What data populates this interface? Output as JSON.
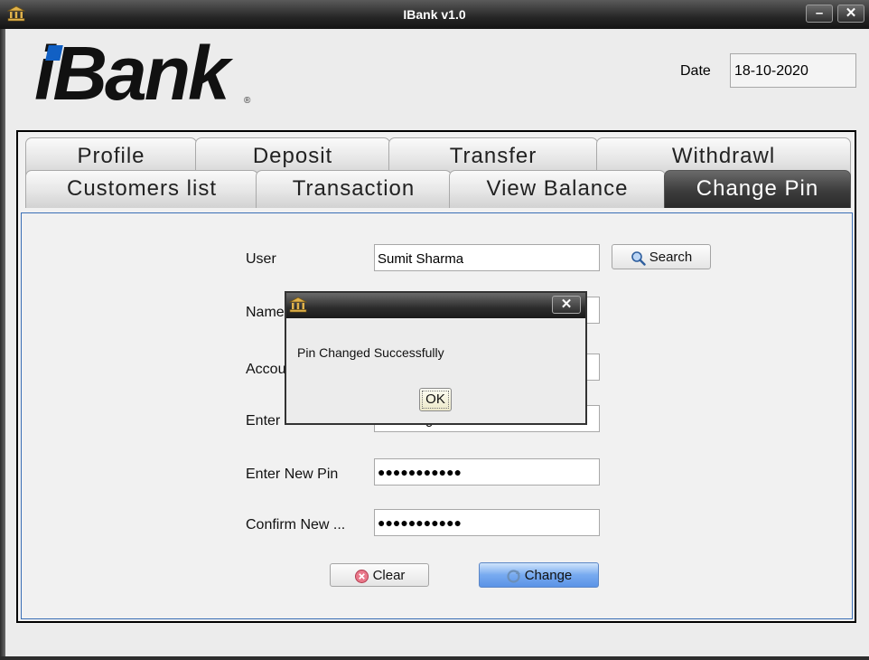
{
  "window": {
    "title": "IBank v1.0",
    "minimize_glyph": "–",
    "close_glyph": "✕",
    "app_icon": "bank-icon"
  },
  "logo": {
    "text": "iBank",
    "mark": "®"
  },
  "header": {
    "date_label": "Date",
    "date_value": "18-10-2020"
  },
  "tabs": {
    "row1": [
      {
        "label": "Profile"
      },
      {
        "label": "Deposit"
      },
      {
        "label": "Transfer"
      },
      {
        "label": "Withdrawl"
      }
    ],
    "row2": [
      {
        "label": "Customers list"
      },
      {
        "label": "Transaction"
      },
      {
        "label": "View Balance"
      },
      {
        "label": "Change Pin",
        "selected": true
      }
    ]
  },
  "form": {
    "user_label": "User",
    "user_value": "Sumit Sharma",
    "search_button": "Search",
    "name_label": "Name",
    "account_label": "Accou",
    "enter_label": "Enter",
    "enter_partial_value": "g",
    "new_pin_label": "Enter New Pin",
    "new_pin_value": "●●●●●●●●●●●",
    "confirm_label": "Confirm New ...",
    "confirm_value": "●●●●●●●●●●●",
    "clear_button": "Clear",
    "change_button": "Change"
  },
  "dialog": {
    "close_glyph": "✕",
    "message": "Pin Changed Successfully",
    "ok_button": "OK"
  },
  "colors": {
    "accent": "#1160c4",
    "selected_tab": "#3c3c3c",
    "content_border": "#3b6fb6"
  }
}
